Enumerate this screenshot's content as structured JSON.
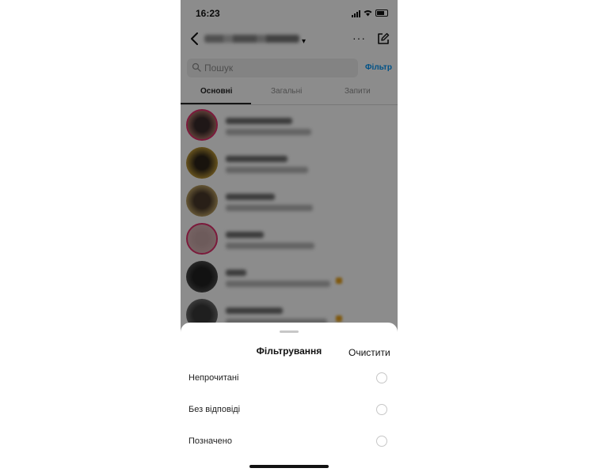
{
  "status_bar": {
    "time": "16:23"
  },
  "header": {
    "username": "",
    "more_label": "···"
  },
  "search": {
    "placeholder": "Пошук",
    "filter_label": "Фільтр"
  },
  "tabs": [
    {
      "label": "Основні",
      "active": true
    },
    {
      "label": "Загальні",
      "active": false
    },
    {
      "label": "Запити",
      "active": false
    }
  ],
  "colors": {
    "accent": "#0095f6",
    "story_ring": "#e1306c",
    "overlay": "rgba(0,0,0,0.45)"
  },
  "filter_sheet": {
    "title": "Фільтрування",
    "clear_label": "Очистити",
    "options": [
      {
        "label": "Непрочитані",
        "checked": false
      },
      {
        "label": "Без відповіді",
        "checked": false
      },
      {
        "label": "Позначено",
        "checked": false
      }
    ]
  }
}
